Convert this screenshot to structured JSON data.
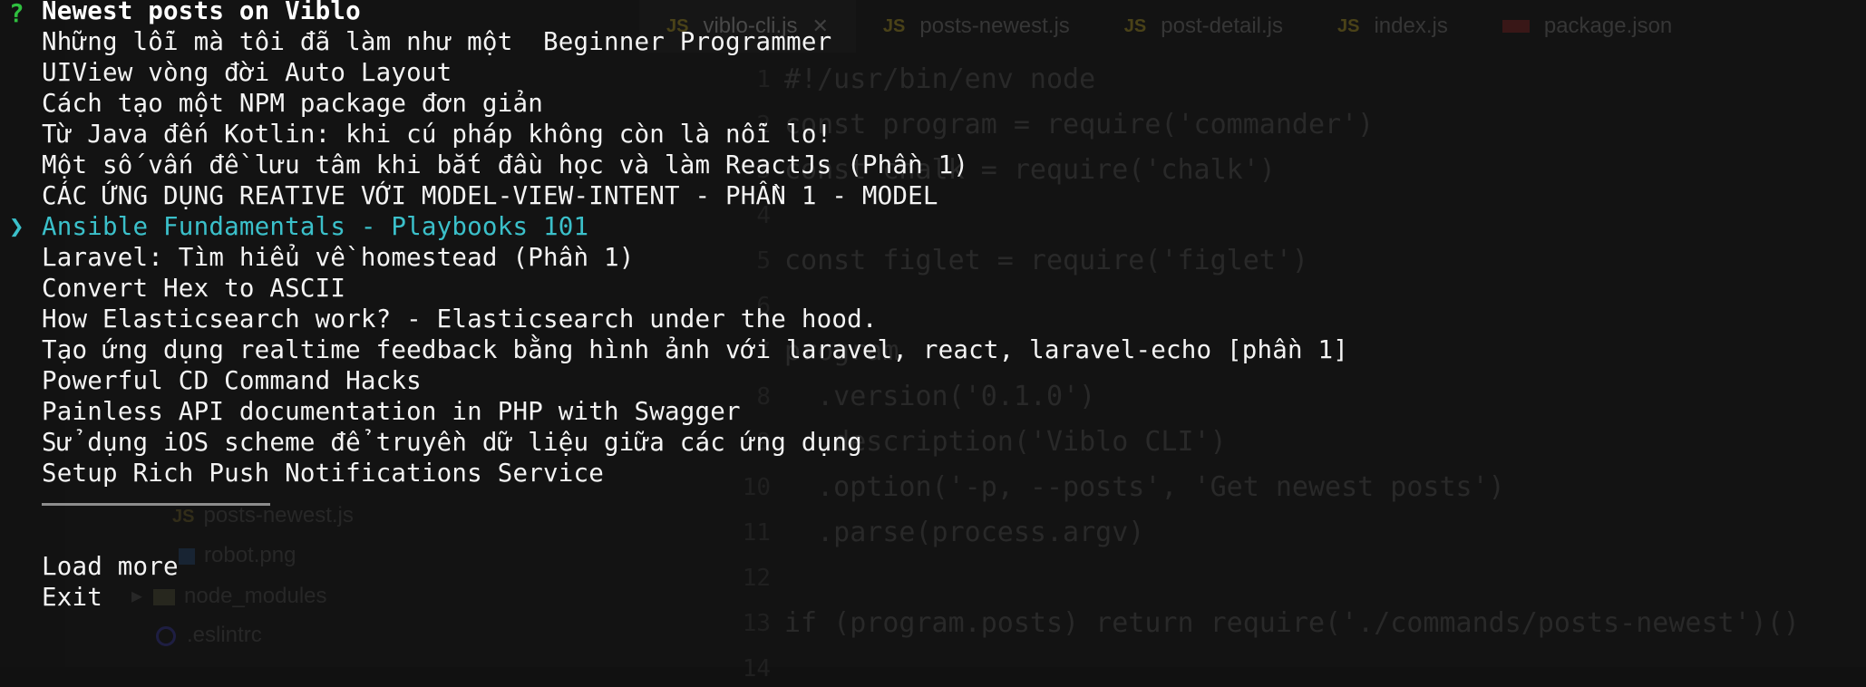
{
  "editor": {
    "tabs": [
      {
        "icon": "JS",
        "label": "viblo-cli.js",
        "active": true,
        "close": "✕"
      },
      {
        "icon": "JS",
        "label": "posts-newest.js"
      },
      {
        "icon": "JS",
        "label": "post-detail.js"
      },
      {
        "icon": "JS",
        "label": "index.js"
      },
      {
        "icon": "pkg",
        "label": "package.json"
      }
    ],
    "code": [
      {
        "n": "1",
        "text": "#!/usr/bin/env node"
      },
      {
        "n": "2",
        "text": "const program = require('commander')"
      },
      {
        "n": "3",
        "text": "const chalk = require('chalk')"
      },
      {
        "n": "4",
        "text": ""
      },
      {
        "n": "5",
        "text": "const figlet = require('figlet')"
      },
      {
        "n": "6",
        "text": ""
      },
      {
        "n": "7",
        "text": "program"
      },
      {
        "n": "8",
        "text": "  .version('0.1.0')"
      },
      {
        "n": "9",
        "text": "  .description('Viblo CLI')"
      },
      {
        "n": "10",
        "text": "  .option('-p, --posts', 'Get newest posts')"
      },
      {
        "n": "11",
        "text": "  .parse(process.argv)"
      },
      {
        "n": "12",
        "text": ""
      },
      {
        "n": "13",
        "text": "if (program.posts) return require('./commands/posts-newest')()"
      },
      {
        "n": "14",
        "text": ""
      }
    ],
    "tree": [
      {
        "label": "posts-newest.js",
        "kind": "js"
      },
      {
        "label": "robot.png",
        "kind": "img"
      },
      {
        "label": "node_modules",
        "kind": "folder"
      },
      {
        "label": ".eslintrc",
        "kind": "dot"
      }
    ]
  },
  "prompt": {
    "question_mark": "?",
    "title": "Newest posts on Viblo",
    "pointer": "❯",
    "selected_index": 6,
    "posts": [
      "Những lỗi mà tôi đã làm như một  Beginner Programmer",
      "UIView vòng đời Auto Layout",
      "Cách tạo một NPM package đơn giản",
      "Từ Java đến Kotlin: khi cú pháp không còn là nỗi lo!",
      "Một số vấn đề lưu tâm khi bắt đầu học và làm ReactJs (Phần 1)",
      "CÁC ỨNG DỤNG REATIVE VỚI MODEL-VIEW-INTENT - PHẦN 1 - MODEL",
      "Ansible Fundamentals - Playbooks 101",
      "Laravel: Tìm hiểu về homestead (Phần 1)",
      "Convert Hex to ASCII",
      "How Elasticsearch work? - Elasticsearch under the hood.",
      "Tạo ứng dụng realtime feedback bằng hình ảnh với laravel, react, laravel-echo [phần 1]",
      "Powerful CD Command Hacks",
      "Painless API documentation in PHP with Swagger",
      "Sử dụng iOS scheme để truyền dữ liệu giữa các ứng dụng",
      "Setup Rich Push Notifications Service"
    ],
    "actions": [
      "Load more",
      "Exit"
    ],
    "colors": {
      "question": "#2fbf3f",
      "selected": "#3bc0ca",
      "text": "#f4f4f4",
      "background": "#111111"
    }
  }
}
